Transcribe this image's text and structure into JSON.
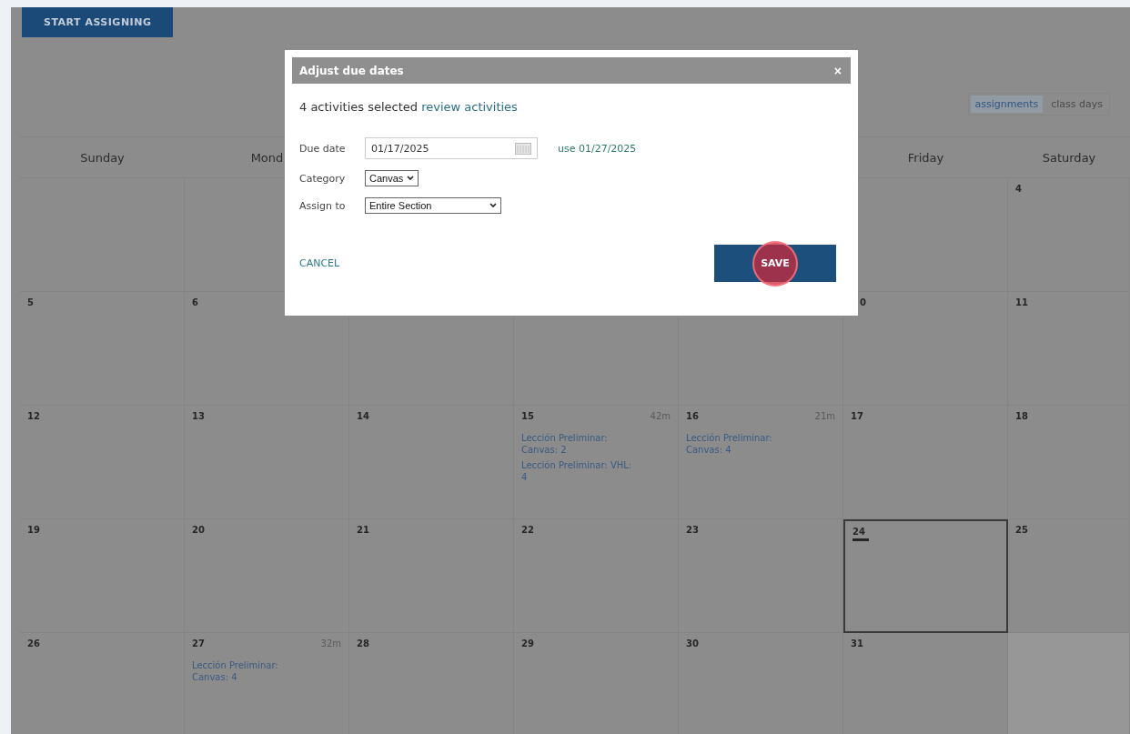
{
  "toolbar": {
    "start_button": "START ASSIGNING",
    "view_toggle": [
      {
        "label": "assignments",
        "selected": true
      },
      {
        "label": "class days",
        "selected": false
      }
    ]
  },
  "calendar": {
    "weekdays": [
      {
        "kind": "label",
        "label": "Sunday"
      },
      {
        "kind": "label",
        "label": "Mond"
      },
      {
        "kind": "blank"
      },
      {
        "kind": "blank"
      },
      {
        "kind": "blank"
      },
      {
        "kind": "label",
        "label": "Friday"
      },
      {
        "kind": "label",
        "label": "Saturday"
      }
    ],
    "weeks": [
      {
        "days": [
          {
            "kind": "blank"
          },
          {
            "kind": "blank"
          },
          {
            "kind": "blank"
          },
          {
            "kind": "blank"
          },
          {
            "kind": "blank"
          },
          {
            "kind": "blank"
          },
          {
            "day": "4"
          }
        ]
      },
      {
        "days": [
          {
            "day": "5"
          },
          {
            "day": "6"
          },
          {
            "kind": "blank"
          },
          {
            "kind": "blank"
          },
          {
            "kind": "blank"
          },
          {
            "kind": "partial",
            "day": "0"
          },
          {
            "day": "11"
          }
        ]
      },
      {
        "days": [
          {
            "day": "12"
          },
          {
            "day": "13"
          },
          {
            "day": "14"
          },
          {
            "day": "15",
            "duration": "42m",
            "events": [
              "Lección Preliminar: Canvas: 2",
              "Lección Preliminar: VHL: 4"
            ]
          },
          {
            "day": "16",
            "duration": "21m",
            "events": [
              "Lección Preliminar: Canvas: 4"
            ]
          },
          {
            "day": "17"
          },
          {
            "day": "18"
          }
        ]
      },
      {
        "days": [
          {
            "day": "19"
          },
          {
            "day": "20"
          },
          {
            "day": "21"
          },
          {
            "day": "22"
          },
          {
            "day": "23"
          },
          {
            "day": "24",
            "today": true
          },
          {
            "day": "25"
          }
        ]
      },
      {
        "days": [
          {
            "day": "26"
          },
          {
            "day": "27",
            "duration": "32m",
            "events": [
              "Lección Preliminar: Canvas: 4"
            ]
          },
          {
            "day": "28"
          },
          {
            "day": "29"
          },
          {
            "day": "30"
          },
          {
            "day": "31"
          },
          {
            "outside": true
          }
        ]
      }
    ]
  },
  "dialog": {
    "title": "Adjust due dates",
    "close": "×",
    "summary": "4 activities selected",
    "review_link": "review activities",
    "due_date": {
      "label": "Due date",
      "value": "01/17/2025",
      "suggestion": "use 01/27/2025"
    },
    "category": {
      "label": "Category",
      "value": "Canvas"
    },
    "assign_to": {
      "label": "Assign to",
      "value": "Entire Section"
    },
    "cancel": "CANCEL",
    "save": "SAVE",
    "save_clicked": true
  }
}
